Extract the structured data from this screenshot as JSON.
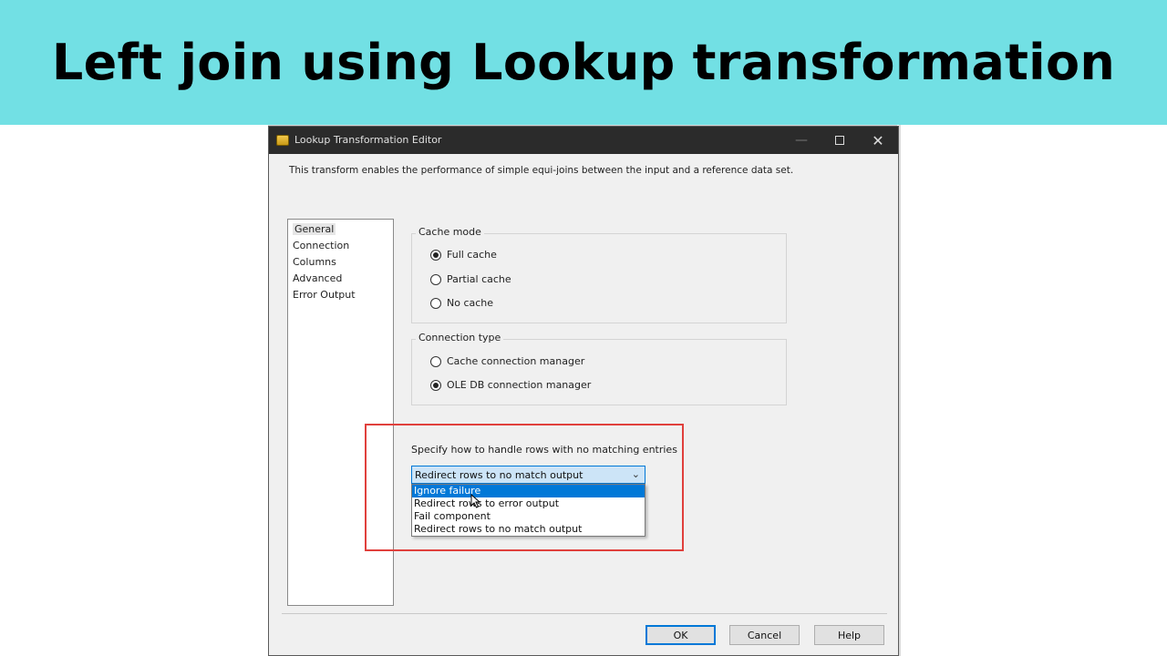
{
  "banner": {
    "title": "Left join using Lookup transformation"
  },
  "window": {
    "title": "Lookup Transformation Editor",
    "minimize_glyph": "—",
    "close_glyph": "✕"
  },
  "description": "This transform enables the performance of simple equi-joins between the input and a reference data set.",
  "nav": {
    "items": [
      {
        "label": "General",
        "selected": true
      },
      {
        "label": "Connection",
        "selected": false
      },
      {
        "label": "Columns",
        "selected": false
      },
      {
        "label": "Advanced",
        "selected": false
      },
      {
        "label": "Error Output",
        "selected": false
      }
    ]
  },
  "cache_mode": {
    "legend": "Cache mode",
    "options": [
      {
        "label": "Full cache",
        "checked": true
      },
      {
        "label": "Partial cache",
        "checked": false
      },
      {
        "label": "No cache",
        "checked": false
      }
    ]
  },
  "connection_type": {
    "legend": "Connection type",
    "options": [
      {
        "label": "Cache connection manager",
        "checked": false
      },
      {
        "label": "OLE DB connection manager",
        "checked": true
      }
    ]
  },
  "no_match": {
    "label": "Specify how to handle rows with no matching entries",
    "selected_value": "Redirect rows to no match output",
    "options": [
      "Ignore failure",
      "Redirect rows to error output",
      "Fail component",
      "Redirect rows to no match output"
    ],
    "highlighted_index": 0
  },
  "buttons": {
    "ok": "OK",
    "cancel": "Cancel",
    "help": "Help"
  },
  "colors": {
    "banner": "#72e0e4",
    "accent": "#0078d7",
    "highlight_box": "#e0403c"
  }
}
